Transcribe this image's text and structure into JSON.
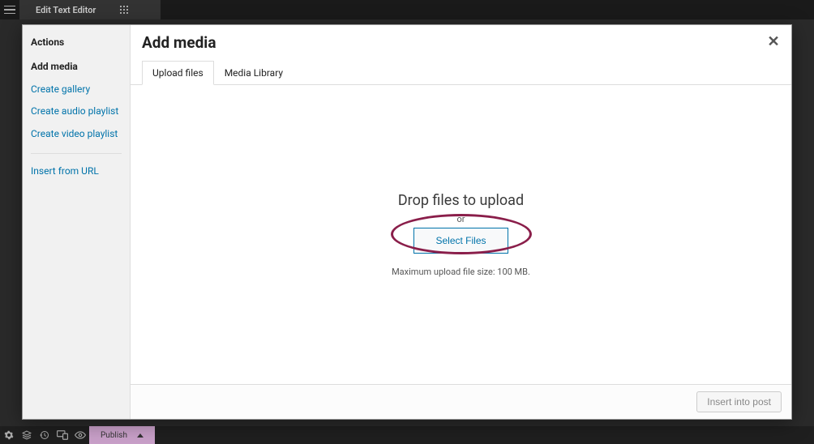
{
  "background": {
    "editor_title": "Edit Text Editor",
    "publish_label": "Publish"
  },
  "modal": {
    "title": "Add media",
    "close_glyph": "✕"
  },
  "sidebar": {
    "heading": "Actions",
    "items": [
      {
        "label": "Add media",
        "active": true
      },
      {
        "label": "Create gallery",
        "active": false
      },
      {
        "label": "Create audio playlist",
        "active": false
      },
      {
        "label": "Create video playlist",
        "active": false
      }
    ],
    "insert_from_url": "Insert from URL"
  },
  "tabs": {
    "upload": "Upload files",
    "library": "Media Library"
  },
  "upload": {
    "drop_title": "Drop files to upload",
    "or": "or",
    "select_button": "Select Files",
    "max_note": "Maximum upload file size: 100 MB."
  },
  "footer": {
    "insert_button": "Insert into post"
  }
}
